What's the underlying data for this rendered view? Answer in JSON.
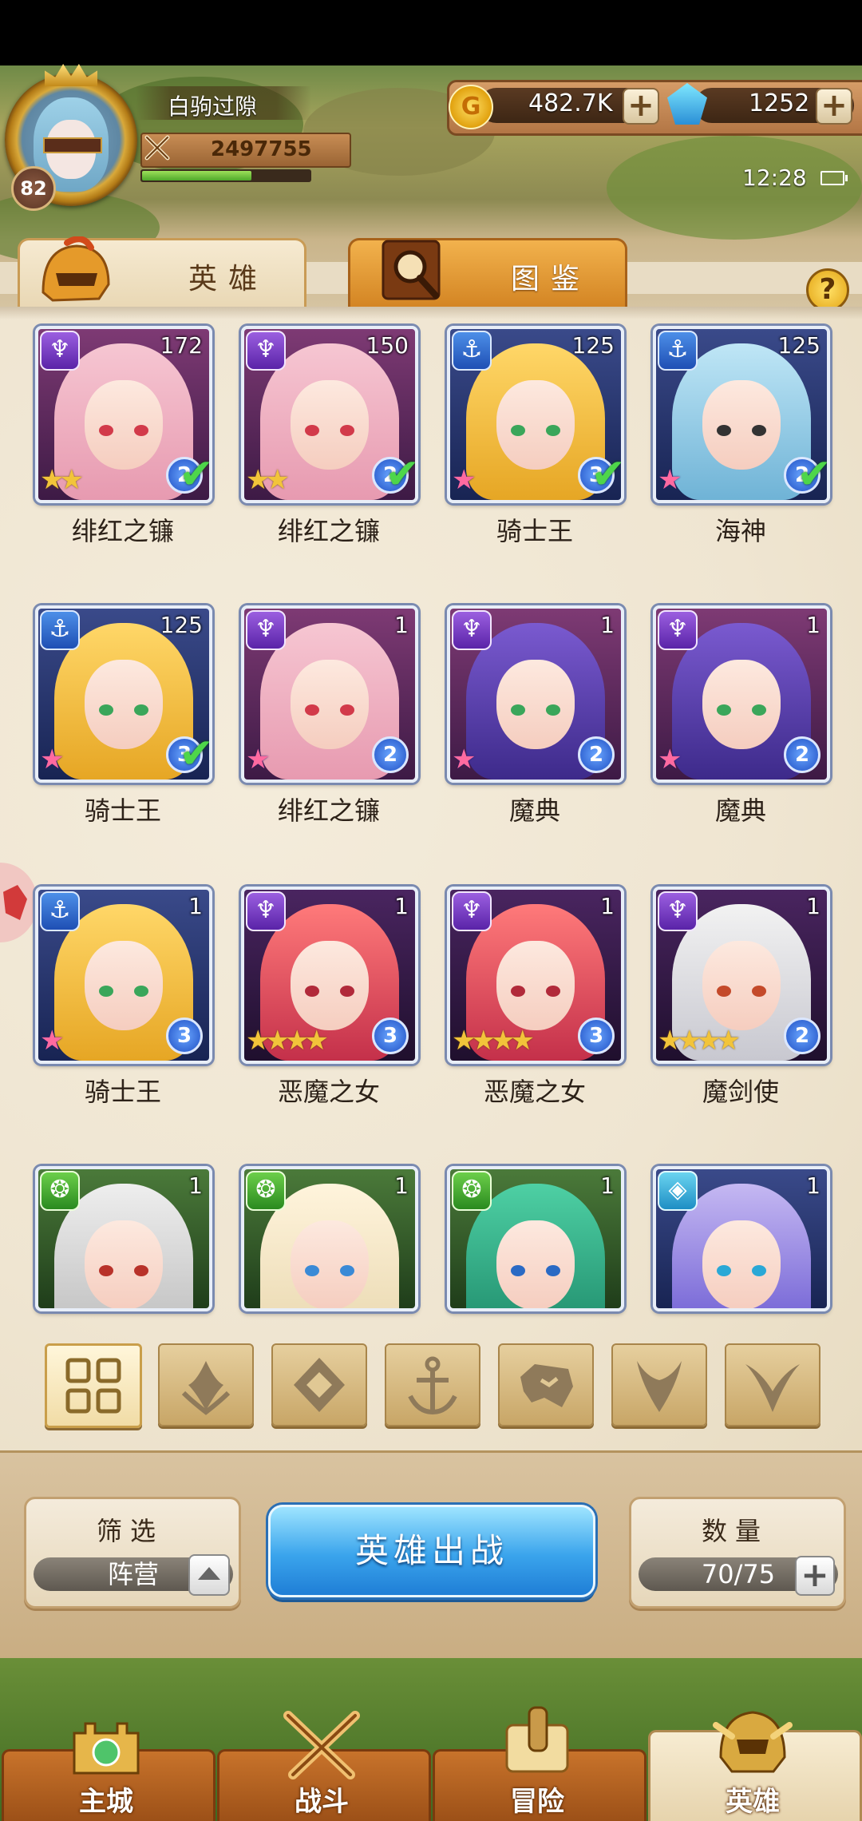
{
  "player": {
    "name": "白驹过隙",
    "level": "82",
    "power": "2497755",
    "exp_fraction": 0.65
  },
  "currency": {
    "gold": "482.7K",
    "gems": "1252",
    "gold_symbol": "G"
  },
  "status": {
    "time": "12:28"
  },
  "tabs": [
    {
      "label": "英雄",
      "active": true
    },
    {
      "label": "图鉴",
      "active": false
    }
  ],
  "help_symbol": "?",
  "heroes": [
    {
      "name": "绯红之镰",
      "level": "172",
      "rank": "2",
      "stars": "★★",
      "faction": "demon",
      "owned": true,
      "theme": "pink"
    },
    {
      "name": "绯红之镰",
      "level": "150",
      "rank": "2",
      "stars": "★★",
      "faction": "demon",
      "owned": true,
      "theme": "pink"
    },
    {
      "name": "骑士王",
      "level": "125",
      "rank": "3",
      "stars": "★",
      "faction": "anchor",
      "owned": true,
      "theme": "blonde"
    },
    {
      "name": "海神",
      "level": "125",
      "rank": "2",
      "stars": "★",
      "faction": "anchor",
      "owned": true,
      "theme": "blue"
    },
    {
      "name": "骑士王",
      "level": "125",
      "rank": "3",
      "stars": "★",
      "faction": "anchor",
      "owned": true,
      "theme": "blonde"
    },
    {
      "name": "绯红之镰",
      "level": "1",
      "rank": "2",
      "stars": "★",
      "faction": "demon",
      "owned": false,
      "theme": "pink"
    },
    {
      "name": "魔典",
      "level": "1",
      "rank": "2",
      "stars": "★",
      "faction": "demon",
      "owned": false,
      "theme": "violet"
    },
    {
      "name": "魔典",
      "level": "1",
      "rank": "2",
      "stars": "★",
      "faction": "demon",
      "owned": false,
      "theme": "violet"
    },
    {
      "name": "骑士王",
      "level": "1",
      "rank": "3",
      "stars": "★",
      "faction": "anchor",
      "owned": false,
      "theme": "blonde"
    },
    {
      "name": "恶魔之女",
      "level": "1",
      "rank": "3",
      "stars": "★★★★",
      "faction": "demon",
      "owned": false,
      "theme": "red"
    },
    {
      "name": "恶魔之女",
      "level": "1",
      "rank": "3",
      "stars": "★★★★",
      "faction": "demon",
      "owned": false,
      "theme": "red"
    },
    {
      "name": "魔剑使",
      "level": "1",
      "rank": "2",
      "stars": "★★★★",
      "faction": "demon",
      "owned": false,
      "theme": "white"
    },
    {
      "name": "",
      "level": "1",
      "rank": "",
      "stars": "",
      "faction": "beast",
      "owned": false,
      "theme": "silver"
    },
    {
      "name": "",
      "level": "1",
      "rank": "",
      "stars": "",
      "faction": "beast",
      "owned": false,
      "theme": "cream"
    },
    {
      "name": "",
      "level": "1",
      "rank": "",
      "stars": "",
      "faction": "beast",
      "owned": false,
      "theme": "teal"
    },
    {
      "name": "",
      "level": "1",
      "rank": "",
      "stars": "",
      "faction": "celestial",
      "owned": false,
      "theme": "cyan"
    }
  ],
  "filters": [
    "all-grid-icon",
    "flame-faction-icon",
    "diamond-faction-icon",
    "anchor-faction-icon",
    "beast-faction-icon",
    "demon-faction-icon",
    "horns-faction-icon"
  ],
  "filter_box": {
    "title": "筛选",
    "value": "阵营"
  },
  "deploy_button": "英雄出战",
  "count_box": {
    "title": "数量",
    "value": "70/75"
  },
  "nav": [
    {
      "label": "主城",
      "icon": "castle-icon",
      "active": false
    },
    {
      "label": "战斗",
      "icon": "crossed-swords-icon",
      "active": false
    },
    {
      "label": "冒险",
      "icon": "map-scroll-icon",
      "active": false
    },
    {
      "label": "英雄",
      "icon": "hero-helmet-icon",
      "active": true
    }
  ]
}
